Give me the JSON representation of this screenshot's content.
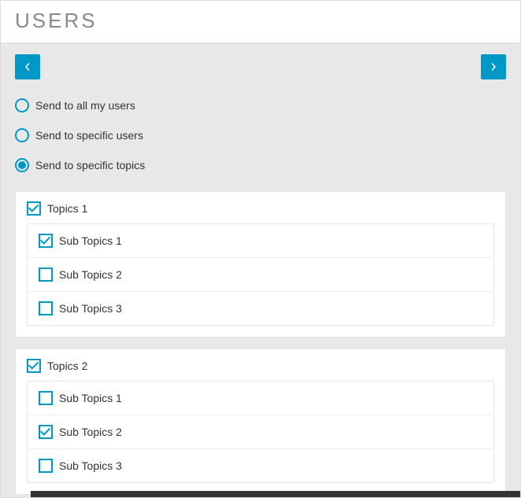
{
  "header": {
    "title": "USERS"
  },
  "colors": {
    "accent": "#0099c7"
  },
  "radios": [
    {
      "label": "Send to all my users",
      "checked": false
    },
    {
      "label": "Send to specific users",
      "checked": false
    },
    {
      "label": "Send to specific topics",
      "checked": true
    }
  ],
  "topics": [
    {
      "label": "Topics 1",
      "checked": true,
      "subtopics": [
        {
          "label": "Sub Topics 1",
          "checked": true
        },
        {
          "label": "Sub Topics 2",
          "checked": false
        },
        {
          "label": "Sub Topics 3",
          "checked": false
        }
      ]
    },
    {
      "label": "Topics 2",
      "checked": true,
      "subtopics": [
        {
          "label": "Sub Topics 1",
          "checked": false
        },
        {
          "label": "Sub Topics 2",
          "checked": true
        },
        {
          "label": "Sub Topics 3",
          "checked": false
        }
      ]
    }
  ]
}
